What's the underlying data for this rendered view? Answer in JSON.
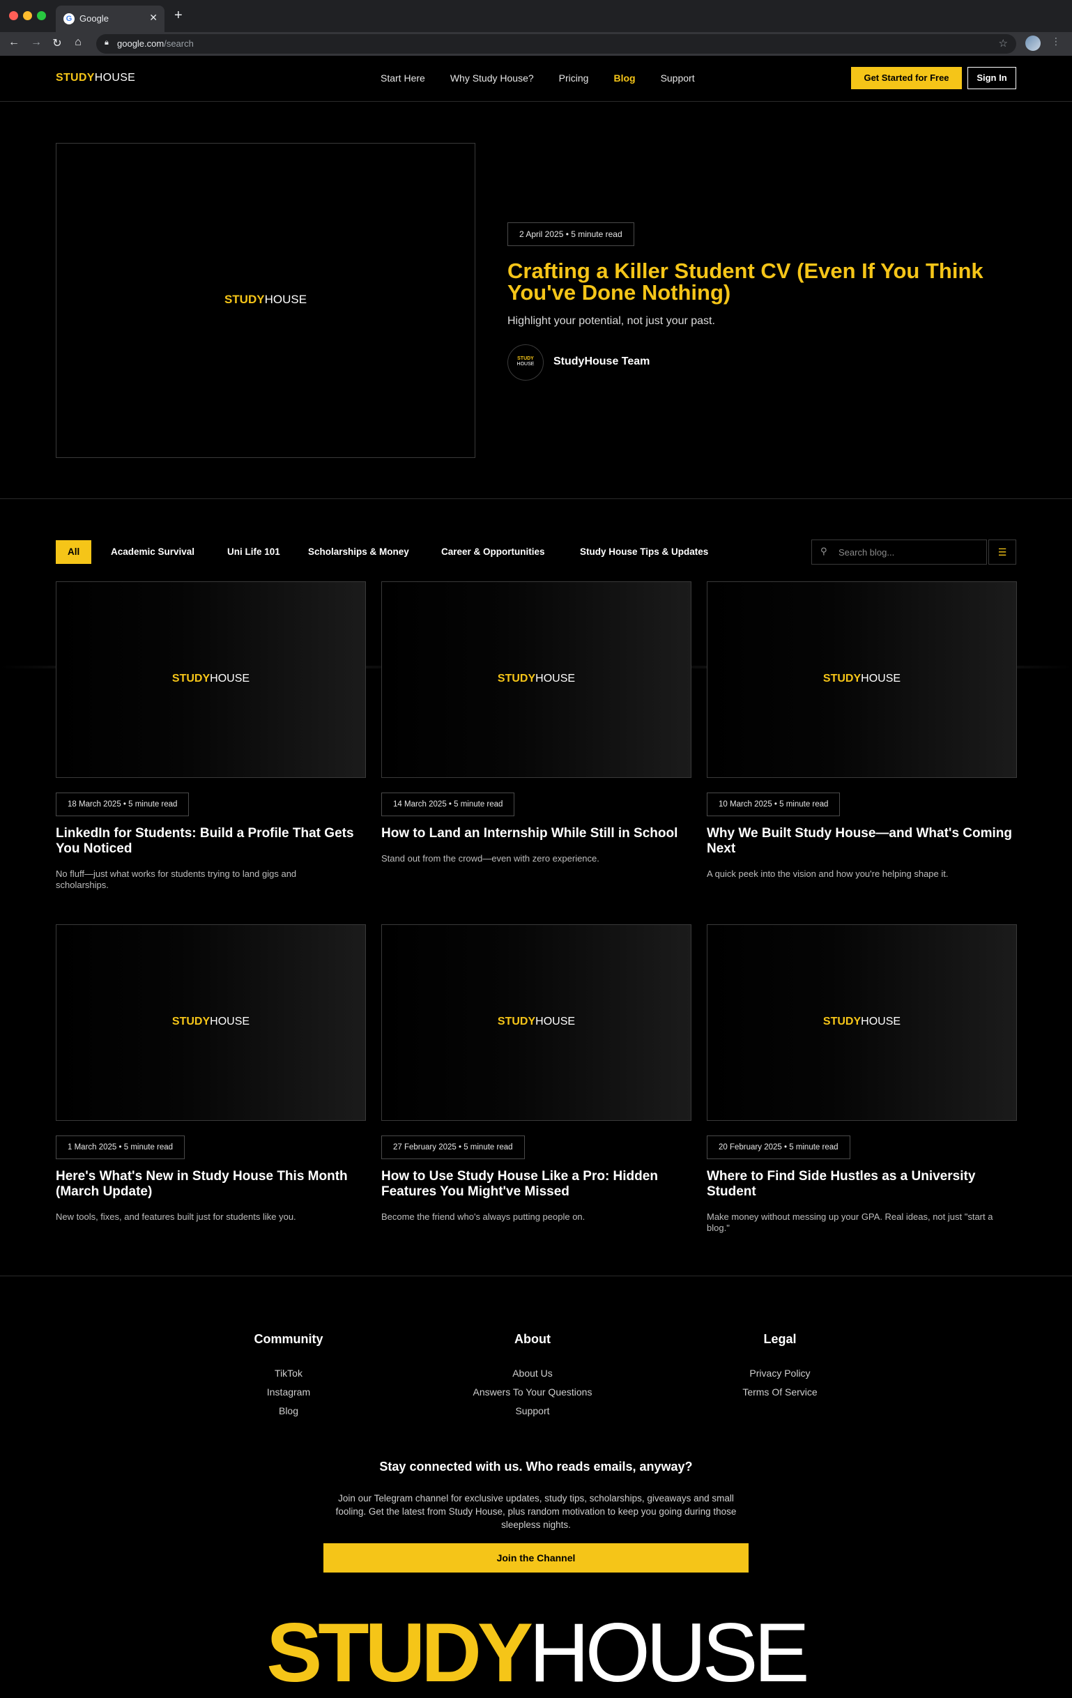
{
  "browser": {
    "tab_title": "Google",
    "tab_favicon": "G",
    "url_host": "google.com",
    "url_path": "/search"
  },
  "brand": {
    "part1": "STUDY",
    "part2": "HOUSE",
    "accent": "#f5c518"
  },
  "nav": {
    "items": [
      "Start Here",
      "Why Study House?",
      "Pricing",
      "Blog",
      "Support"
    ],
    "active": "Blog",
    "cta_label": "Get Started for Free",
    "signin_label": "Sign In"
  },
  "hero": {
    "meta": "2 April 2025 • 5 minute read",
    "title": "Crafting a Killer Student CV (Even If You Think You've Done Nothing)",
    "subtitle": "Highlight your potential, not just your past.",
    "author_avatar_line1": "STUDY",
    "author_avatar_line2": "HOUSE",
    "author": "StudyHouse Team"
  },
  "filters": {
    "categories": [
      "All",
      "Academic Survival",
      "Uni Life 101",
      "Scholarships & Money",
      "Career & Opportunities",
      "Study House Tips & Updates"
    ],
    "active": "All",
    "search_placeholder": "Search blog..."
  },
  "posts": [
    {
      "meta": "18 March 2025 • 5 minute read",
      "title": "LinkedIn for Students: Build a Profile That Gets You Noticed",
      "excerpt": "No fluff—just what works for students trying to land gigs and scholarships."
    },
    {
      "meta": "14 March 2025 • 5 minute read",
      "title": "How to Land an Internship While Still in School",
      "excerpt": "Stand out from the crowd—even with zero experience."
    },
    {
      "meta": "10 March 2025 • 5 minute read",
      "title": "Why We Built Study House—and What's Coming Next",
      "excerpt": "A quick peek into the vision and how you're helping shape it."
    },
    {
      "meta": "1 March 2025 • 5 minute read",
      "title": "Here's What's New in Study House This Month (March Update)",
      "excerpt": "New tools, fixes, and features built just for students like you."
    },
    {
      "meta": "27 February 2025 • 5 minute read",
      "title": "How to Use Study House Like a Pro: Hidden Features You Might've Missed",
      "excerpt": "Become the friend who's always putting people on."
    },
    {
      "meta": "20 February 2025 • 5 minute read",
      "title": "Where to Find Side Hustles as a University Student",
      "excerpt": "Make money without messing up your GPA. Real ideas, not just \"start a blog.\""
    }
  ],
  "footer": {
    "community": {
      "title": "Community",
      "links": [
        "TikTok",
        "Instagram",
        "Blog"
      ]
    },
    "about": {
      "title": "About",
      "links": [
        "About Us",
        "Answers To Your Questions",
        "Support"
      ]
    },
    "legal": {
      "title": "Legal",
      "links": [
        "Privacy Policy",
        "Terms Of Service"
      ]
    },
    "newsletter_heading": "Stay connected with us. Who reads emails, anyway?",
    "newsletter_text": "Join our Telegram channel for exclusive updates, study tips, scholarships, giveaways and small fooling. Get the latest from Study House, plus random motivation to keep you going during those sleepless nights.",
    "channel_button": "Join the Channel"
  }
}
